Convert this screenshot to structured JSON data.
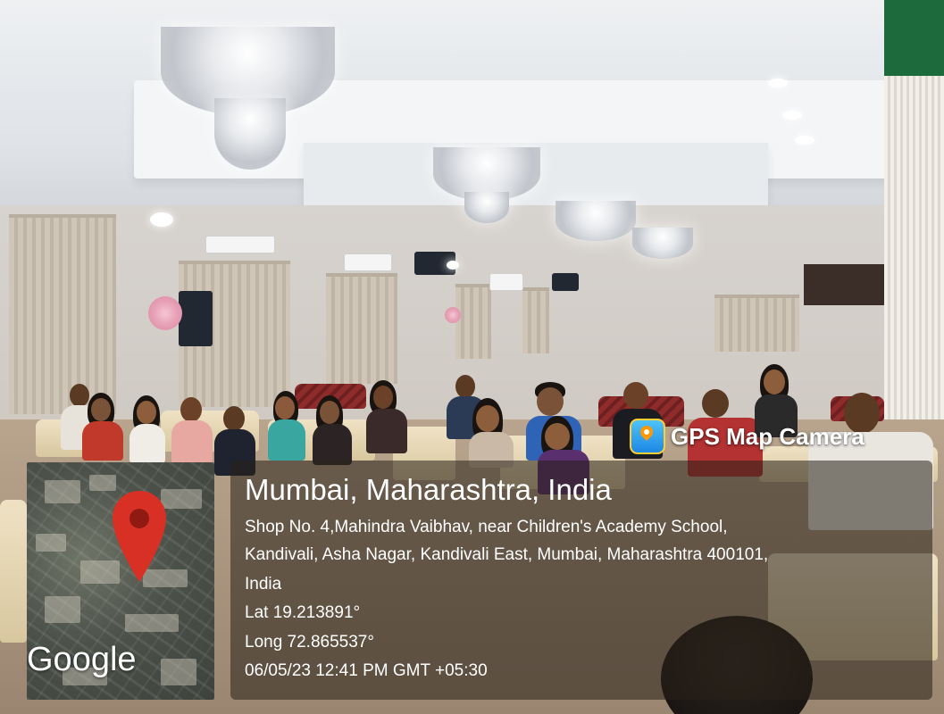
{
  "overlay": {
    "app_name": "GPS Map Camera",
    "app_icon": "gps-map-camera-icon",
    "location_title": "Mumbai, Maharashtra, India",
    "address_line_1": "Shop No. 4,Mahindra Vaibhav, near Children's Academy School,",
    "address_line_2": "Kandivali, Asha Nagar, Kandivali East, Mumbai, Maharashtra 400101,",
    "address_line_3": "India",
    "latitude": "Lat 19.213891°",
    "longitude": "Long 72.865537°",
    "timestamp": "06/05/23 12:41 PM GMT +05:30"
  },
  "map": {
    "logo_text": "Google",
    "pin_color": "#d93025"
  }
}
